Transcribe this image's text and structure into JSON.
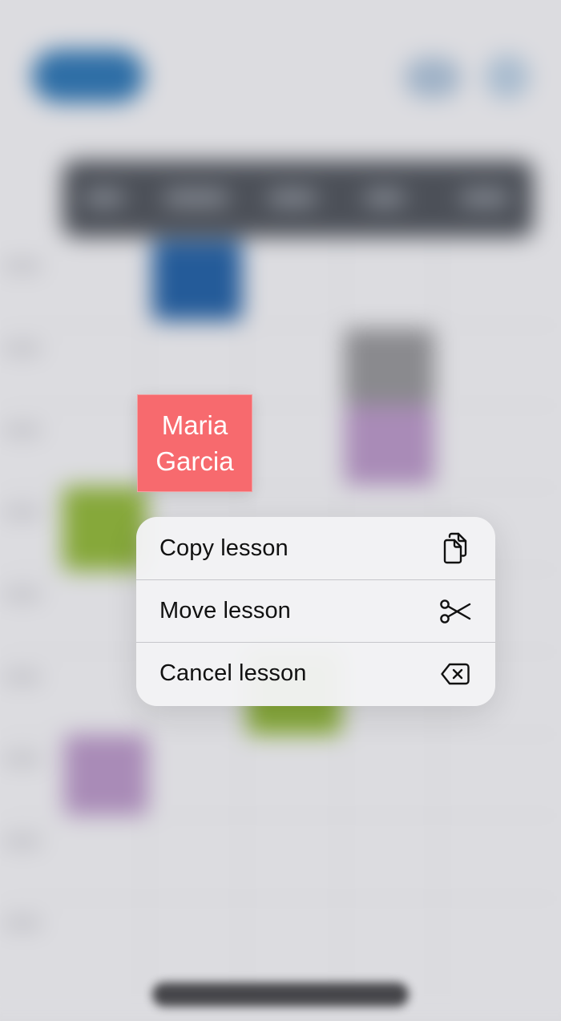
{
  "lesson": {
    "first_name": "Maria",
    "last_name": "Garcia",
    "color": "#f76a6e"
  },
  "context_menu": {
    "items": [
      {
        "label": "Copy lesson",
        "icon": "copy-icon"
      },
      {
        "label": "Move lesson",
        "icon": "scissors-icon"
      },
      {
        "label": "Cancel lesson",
        "icon": "delete-backward-icon"
      }
    ]
  },
  "background": {
    "accent_color": "#2e6ea6",
    "block_colors": [
      "#245b99",
      "#8a8a8e",
      "#a98bb7",
      "#86a83a"
    ]
  }
}
